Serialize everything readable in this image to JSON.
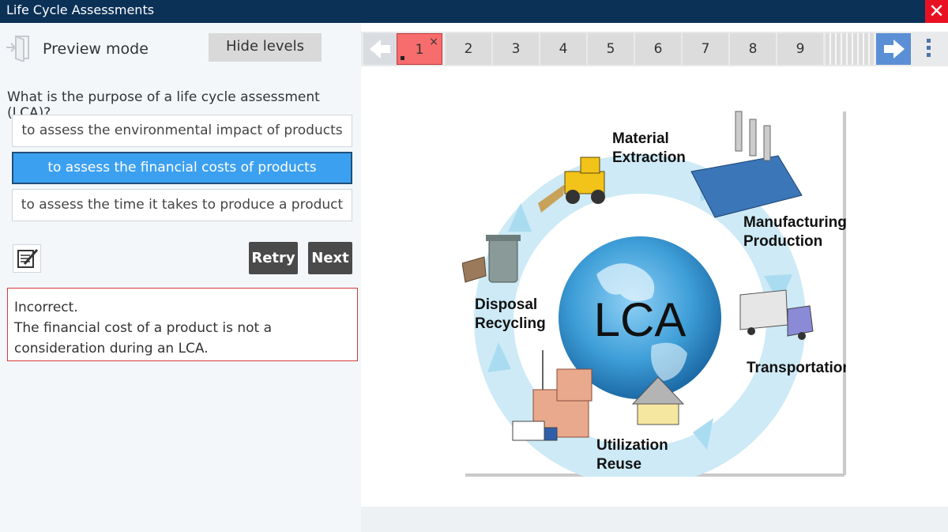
{
  "window": {
    "title": "Life Cycle Assessments",
    "close_glyph": "✕"
  },
  "header": {
    "preview_label": "Preview mode",
    "hide_levels_label": "Hide levels"
  },
  "question": {
    "text": "What is the purpose of a life cycle assessment (LCA)?",
    "answers": [
      {
        "label": "to assess the environmental impact of products",
        "selected": false
      },
      {
        "label": "to assess the financial costs of products",
        "selected": true
      },
      {
        "label": "to assess the time it takes to produce a product",
        "selected": false
      }
    ]
  },
  "actions": {
    "retry_label": "Retry",
    "next_label": "Next"
  },
  "feedback": {
    "status": "Incorrect.",
    "message": "The financial cost of a product is not a consideration during an LCA."
  },
  "nav": {
    "tabs": [
      "1",
      "2",
      "3",
      "4",
      "5",
      "6",
      "7",
      "8",
      "9"
    ],
    "current_index": 0,
    "current_tab_close": "×"
  },
  "diagram": {
    "center_label": "LCA",
    "stages": [
      {
        "line1": "Material",
        "line2": "Extraction"
      },
      {
        "line1": "Manufacturing",
        "line2": "Production"
      },
      {
        "line1": "Transportation",
        "line2": ""
      },
      {
        "line1": "Utilization",
        "line2": "Reuse"
      },
      {
        "line1": "Disposal",
        "line2": "Recycling"
      }
    ]
  },
  "colors": {
    "titlebar": "#0b3157",
    "selected_answer": "#3ca0f0",
    "error_border": "#d9383a",
    "current_tab": "#f76c6c",
    "next_arrow": "#5a8fd6"
  }
}
